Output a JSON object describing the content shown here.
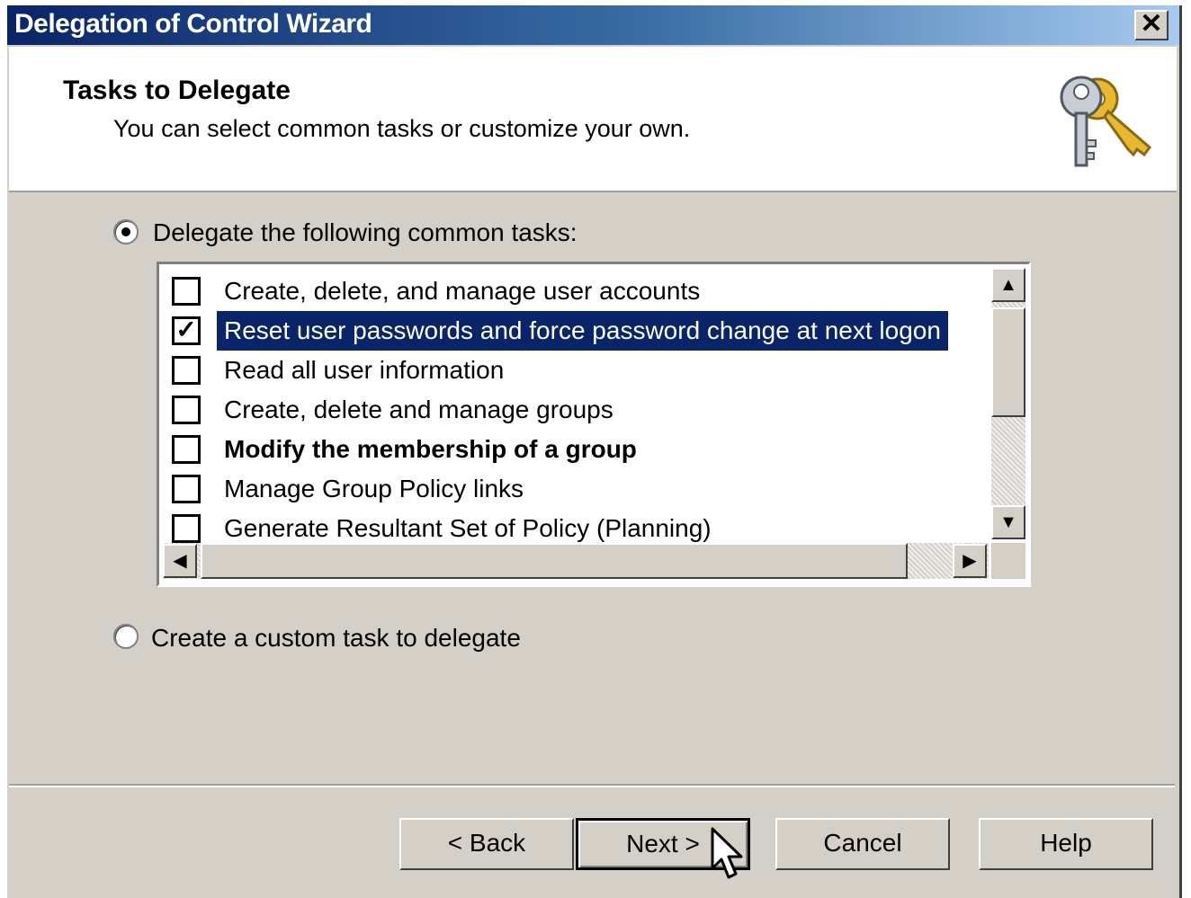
{
  "window": {
    "title": "Delegation of Control Wizard",
    "close_label": "✕"
  },
  "header": {
    "title": "Tasks to Delegate",
    "subtitle": "You can select common tasks or customize your own.",
    "icon": "keys-icon"
  },
  "options": {
    "common_label": "Delegate the following common tasks:",
    "common_selected": true,
    "custom_label": "Create a custom task to delegate",
    "custom_selected": false
  },
  "tasks": [
    {
      "label": "Create, delete, and manage user accounts",
      "checked": false,
      "selected": false,
      "bold": false
    },
    {
      "label": "Reset user passwords and force password change at next logon",
      "checked": true,
      "selected": true,
      "bold": false
    },
    {
      "label": "Read all user information",
      "checked": false,
      "selected": false,
      "bold": false
    },
    {
      "label": "Create, delete and manage groups",
      "checked": false,
      "selected": false,
      "bold": false
    },
    {
      "label": "Modify the membership of a group",
      "checked": false,
      "selected": false,
      "bold": true
    },
    {
      "label": "Manage Group Policy links",
      "checked": false,
      "selected": false,
      "bold": false
    },
    {
      "label": "Generate Resultant Set of Policy (Planning)",
      "checked": false,
      "selected": false,
      "bold": false
    }
  ],
  "buttons": {
    "back": "< Back",
    "next": "Next >",
    "cancel": "Cancel",
    "help": "Help"
  },
  "colors": {
    "selection": "#0a246a",
    "dialog_bg": "#d4d0c8"
  }
}
